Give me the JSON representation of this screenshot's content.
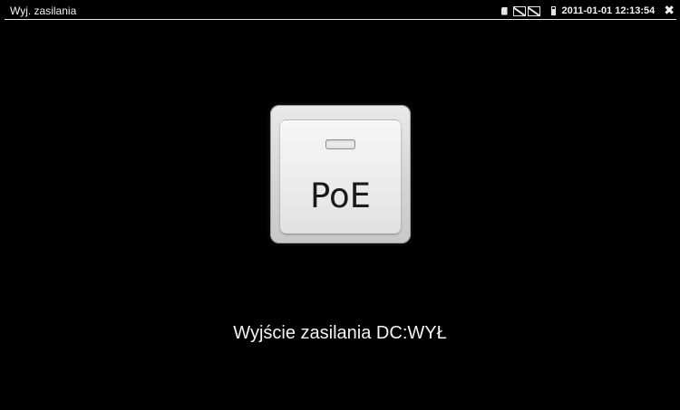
{
  "window": {
    "title": "Wyj. zasilania"
  },
  "status_bar": {
    "icons": [
      "sd-card-icon",
      "network-disconnected-icon",
      "network-disconnected-icon",
      "battery-icon"
    ],
    "datetime": "2011-01-01 12:13:54",
    "close_glyph": "✖"
  },
  "main": {
    "poe_button": {
      "label": "PoE"
    },
    "status_text": "Wyjście zasilania DC:WYŁ"
  },
  "colors": {
    "background": "#000000",
    "text": "#f4f4f4",
    "button_face": "#ececec"
  }
}
